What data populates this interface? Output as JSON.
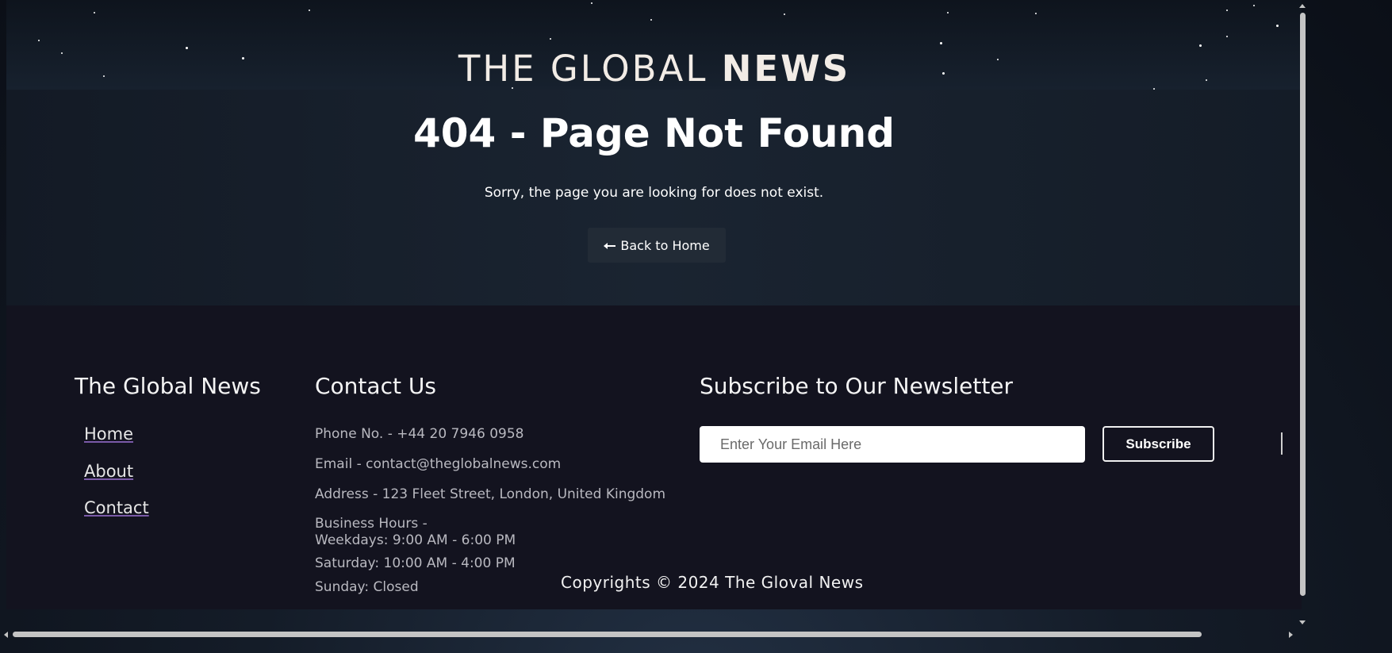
{
  "header": {
    "brand_light": "THE GLOBAL",
    "brand_bold": "NEWS"
  },
  "hero": {
    "title": "404 - Page Not Found",
    "message": "Sorry, the page you are looking for does not exist.",
    "back_button_label": "Back to Home",
    "back_button_icon": "arrow-left-icon"
  },
  "footer": {
    "brand_heading": "The Global News",
    "links": [
      "Home",
      "About",
      "Contact"
    ],
    "contact": {
      "heading": "Contact Us",
      "phone": "Phone No. - +44 20 7946 0958",
      "email": "Email - contact@theglobalnews.com",
      "address": "Address - 123 Fleet Street, London, United Kingdom",
      "hours_label": "Business Hours -",
      "weekdays": "Weekdays: 9:00 AM - 6:00 PM",
      "saturday": "Saturday: 10:00 AM - 4:00 PM",
      "sunday": "Sunday: Closed"
    },
    "newsletter": {
      "heading": "Subscribe to Our Newsletter",
      "email_placeholder": "Enter Your Email Here",
      "email_value": "",
      "subscribe_label": "Subscribe"
    },
    "copyright": "Copyrights © 2024 The Gloval News"
  },
  "colors": {
    "footer_bg": "#13131f",
    "button_bg": "#222b36",
    "link_underline": "#7a5aa8"
  }
}
